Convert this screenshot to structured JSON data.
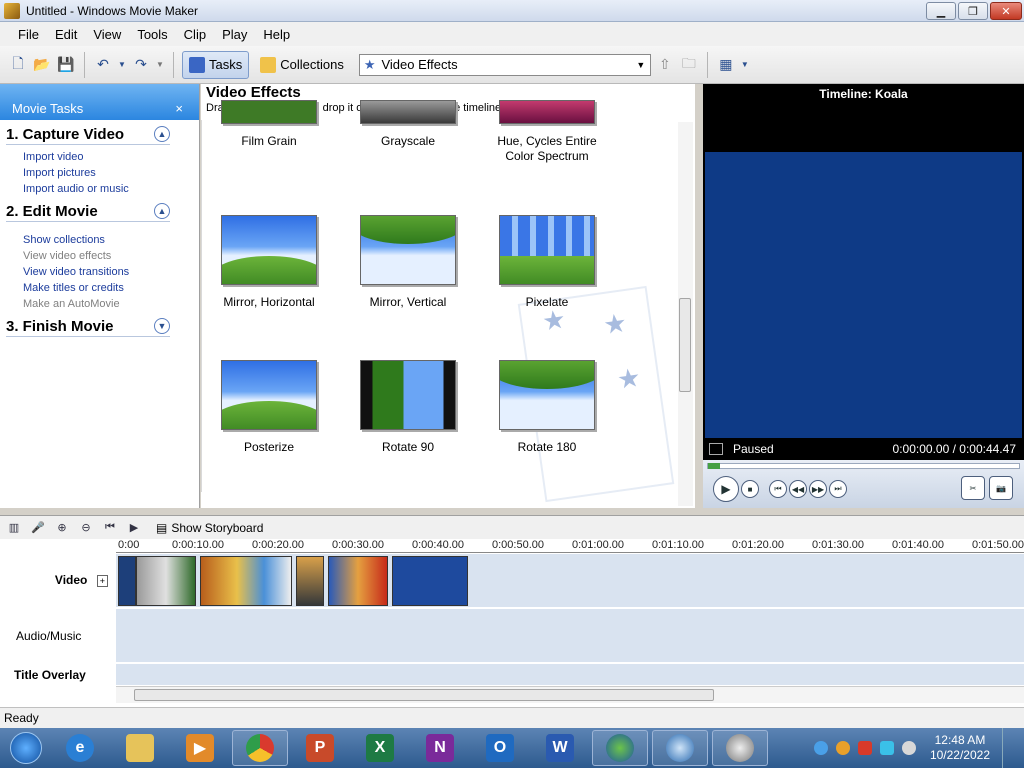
{
  "window": {
    "title": "Untitled - Windows Movie Maker"
  },
  "menu": [
    "File",
    "Edit",
    "View",
    "Tools",
    "Clip",
    "Play",
    "Help"
  ],
  "toolbar": {
    "tasks_label": "Tasks",
    "collections_label": "Collections",
    "combo_value": "Video Effects"
  },
  "taskpane": {
    "title": "Movie Tasks",
    "close_glyph": "×",
    "sections": [
      {
        "title": "1. Capture Video",
        "expand_glyph": "▲",
        "links": [
          {
            "label": "Import video",
            "enabled": true
          },
          {
            "label": "Import pictures",
            "enabled": true
          },
          {
            "label": "Import audio or music",
            "enabled": true
          }
        ]
      },
      {
        "title": "2. Edit Movie",
        "expand_glyph": "▲",
        "links": [
          {
            "label": "Show collections",
            "enabled": true
          },
          {
            "label": "View video effects",
            "enabled": false
          },
          {
            "label": "View video transitions",
            "enabled": true
          },
          {
            "label": "Make titles or credits",
            "enabled": true
          },
          {
            "label": "Make an AutoMovie",
            "enabled": false
          }
        ]
      },
      {
        "title": "3. Finish Movie",
        "expand_glyph": "▼",
        "links": []
      }
    ]
  },
  "effects": {
    "title": "Video Effects",
    "subtitle": "Drag a video effect and drop it on a video clip on the timeline below.",
    "items": [
      {
        "label": "Film Grain"
      },
      {
        "label": "Grayscale"
      },
      {
        "label": "Hue, Cycles Entire Color Spectrum"
      },
      {
        "label": "Mirror, Horizontal"
      },
      {
        "label": "Mirror, Vertical"
      },
      {
        "label": "Pixelate"
      },
      {
        "label": "Posterize"
      },
      {
        "label": "Rotate 90"
      },
      {
        "label": "Rotate 180"
      }
    ]
  },
  "preview": {
    "title": "Timeline: Koala",
    "status": "Paused",
    "time": "0:00:00.00 / 0:00:44.47"
  },
  "timeline": {
    "storyboard_label": "Show Storyboard",
    "tracks": {
      "video": "Video",
      "audio": "Audio/Music",
      "title": "Title Overlay"
    },
    "ticks": [
      "0:00",
      "0:00:10.00",
      "0:00:20.00",
      "0:00:30.00",
      "0:00:40.00",
      "0:00:50.00",
      "0:01:00.00",
      "0:01:10.00",
      "0:01:20.00",
      "0:01:30.00",
      "0:01:40.00",
      "0:01:50.00"
    ]
  },
  "statusbar": {
    "text": "Ready"
  },
  "taskbar": {
    "clock_time": "12:48 AM",
    "clock_date": "10/22/2022",
    "apps": [
      "internet-explorer",
      "file-explorer",
      "media-player",
      "chrome",
      "powerpoint",
      "excel",
      "onenote",
      "outlook",
      "word",
      "media-center",
      "app-swirl",
      "movie-maker"
    ]
  },
  "colors": {
    "accent": "#2b86e0",
    "link": "#1c3c9c",
    "preview_screen": "#0e3a86",
    "track": "#d9e3f0"
  }
}
